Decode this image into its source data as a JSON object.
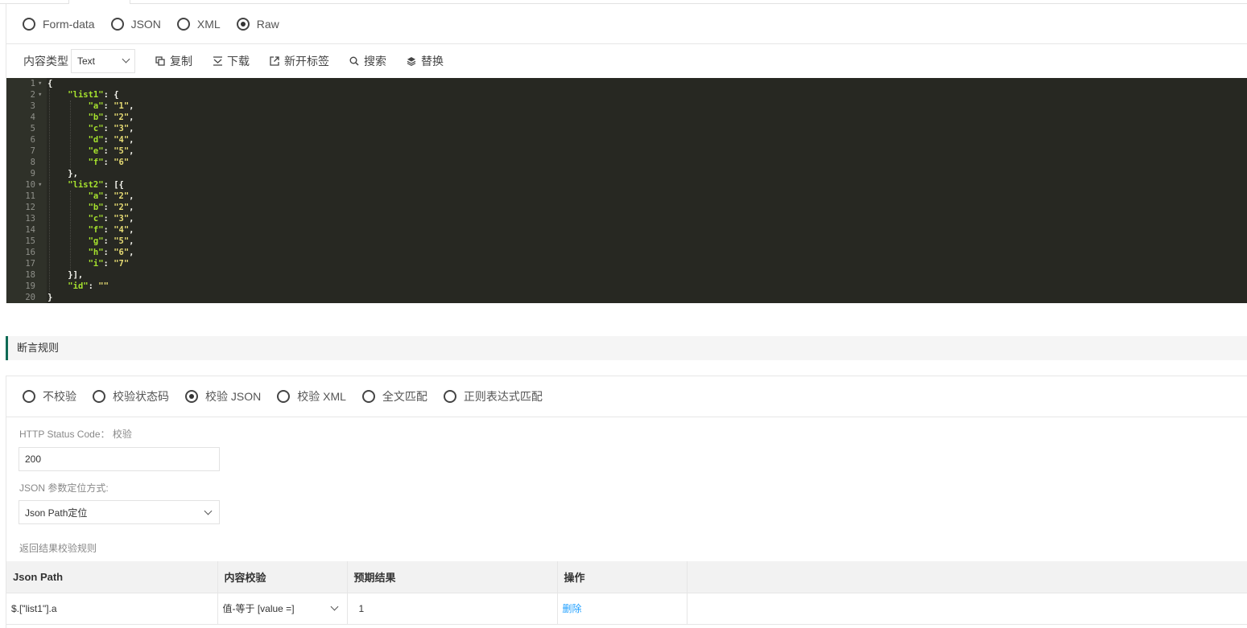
{
  "body_types": [
    {
      "label": "Form-data",
      "checked": false
    },
    {
      "label": "JSON",
      "checked": false
    },
    {
      "label": "XML",
      "checked": false
    },
    {
      "label": "Raw",
      "checked": true
    }
  ],
  "toolbar": {
    "content_type_label": "内容类型",
    "content_type_value": "Text",
    "copy": "复制",
    "download": "下载",
    "new_tab": "新开标签",
    "search": "搜索",
    "replace": "替换"
  },
  "editor": {
    "lines": [
      "{",
      "    \"list1\": {",
      "        \"a\": \"1\",",
      "        \"b\": \"2\",",
      "        \"c\": \"3\",",
      "        \"d\": \"4\",",
      "        \"e\": \"5\",",
      "        \"f\": \"6\"",
      "    },",
      "    \"list2\": [{",
      "        \"a\": \"2\",",
      "        \"b\": \"2\",",
      "        \"c\": \"3\",",
      "        \"f\": \"4\",",
      "        \"g\": \"5\",",
      "        \"h\": \"6\",",
      "        \"i\": \"7\"",
      "    }],",
      "    \"id\": \"\"",
      "}"
    ],
    "fold_lines": [
      1,
      2,
      10
    ]
  },
  "assert": {
    "section_title": "断言规则",
    "modes": [
      {
        "label": "不校验",
        "checked": false
      },
      {
        "label": "校验状态码",
        "checked": false
      },
      {
        "label": "校验 JSON",
        "checked": true
      },
      {
        "label": "校验 XML",
        "checked": false
      },
      {
        "label": "全文匹配",
        "checked": false
      },
      {
        "label": "正则表达式匹配",
        "checked": false
      }
    ],
    "status_code_label": "HTTP Status Code： 校验",
    "status_code_value": "200",
    "locate_label": "JSON 参数定位方式:",
    "locate_value": "Json Path定位",
    "rules_label": "返回结果校验规则",
    "table": {
      "headers": [
        "Json Path",
        "内容校验",
        "预期结果",
        "操作",
        ""
      ],
      "rows": [
        {
          "path": "$.[\"list1\"].a",
          "check": "值-等于 [value =]",
          "expected": "1",
          "action": "删除"
        }
      ]
    }
  }
}
